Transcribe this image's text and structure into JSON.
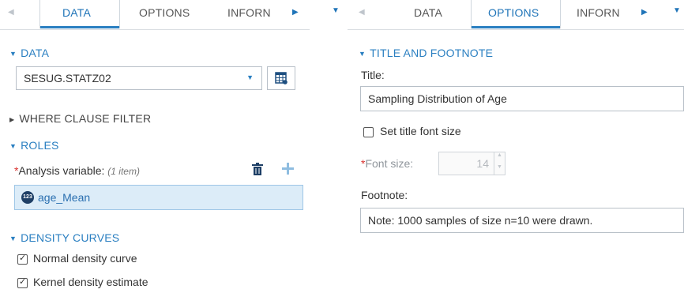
{
  "left": {
    "tabs": [
      {
        "label": "DATA",
        "active": true
      },
      {
        "label": "OPTIONS",
        "active": false
      },
      {
        "label": "INFORN",
        "active": false
      }
    ],
    "data_section": {
      "header": "DATA",
      "selected_table": "SESUG.STATZ02"
    },
    "where_clause": {
      "header": "WHERE CLAUSE FILTER"
    },
    "roles": {
      "header": "ROLES",
      "required_marker": "*",
      "analysis_label": "Analysis variable:",
      "item_count": "(1 item)",
      "items": [
        {
          "type_badge": "123",
          "name": "age_Mean"
        }
      ]
    },
    "density_curves": {
      "header": "DENSITY CURVES",
      "options": [
        {
          "label": "Normal density curve",
          "checked": true
        },
        {
          "label": "Kernel density estimate",
          "checked": true
        }
      ]
    }
  },
  "right": {
    "tabs": [
      {
        "label": "DATA",
        "active": false
      },
      {
        "label": "OPTIONS",
        "active": true
      },
      {
        "label": "INFORN",
        "active": false
      }
    ],
    "title_footnote": {
      "header": "TITLE AND FOOTNOTE",
      "title_label": "Title:",
      "title_value": "Sampling Distribution of Age",
      "set_font_size_label": "Set title font size",
      "set_font_size_checked": false,
      "required_marker": "*",
      "font_size_label": "Font size:",
      "font_size_value": "14",
      "footnote_label": "Footnote:",
      "footnote_value": "Note: 1000 samples of size n=10 were drawn."
    }
  },
  "colors": {
    "accent": "#2a7fc1",
    "selected_row_bg": "#dcecf8",
    "required": "#d9322f"
  },
  "icons": [
    "scroll-left-icon",
    "scroll-right-icon",
    "dropdown-arrow-icon",
    "grid-select-icon",
    "trash-icon",
    "plus-icon",
    "numeric-type-icon"
  ]
}
